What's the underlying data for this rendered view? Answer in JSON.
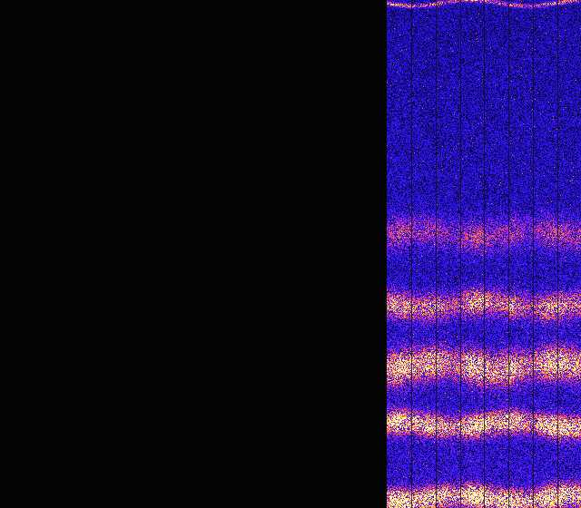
{
  "spectrogram": {
    "colormap": [
      "#000000",
      "#1a0a8c",
      "#2a18ff",
      "#7a22e8",
      "#d2309a",
      "#ff5a5a",
      "#ff9e3a",
      "#ffe27a",
      "#fff6b0"
    ],
    "background_color": "#050505",
    "divider_color": "#0a0a0a",
    "segment_count": 8,
    "bands": [
      {
        "position": 0.005,
        "strength": 0.55,
        "spread": 0.004
      },
      {
        "position": 0.46,
        "strength": 0.3,
        "spread": 0.03
      },
      {
        "position": 0.6,
        "strength": 0.55,
        "spread": 0.025
      },
      {
        "position": 0.72,
        "strength": 0.75,
        "spread": 0.03
      },
      {
        "position": 0.835,
        "strength": 0.9,
        "spread": 0.02
      },
      {
        "position": 0.98,
        "strength": 1.0,
        "spread": 0.02
      }
    ]
  }
}
